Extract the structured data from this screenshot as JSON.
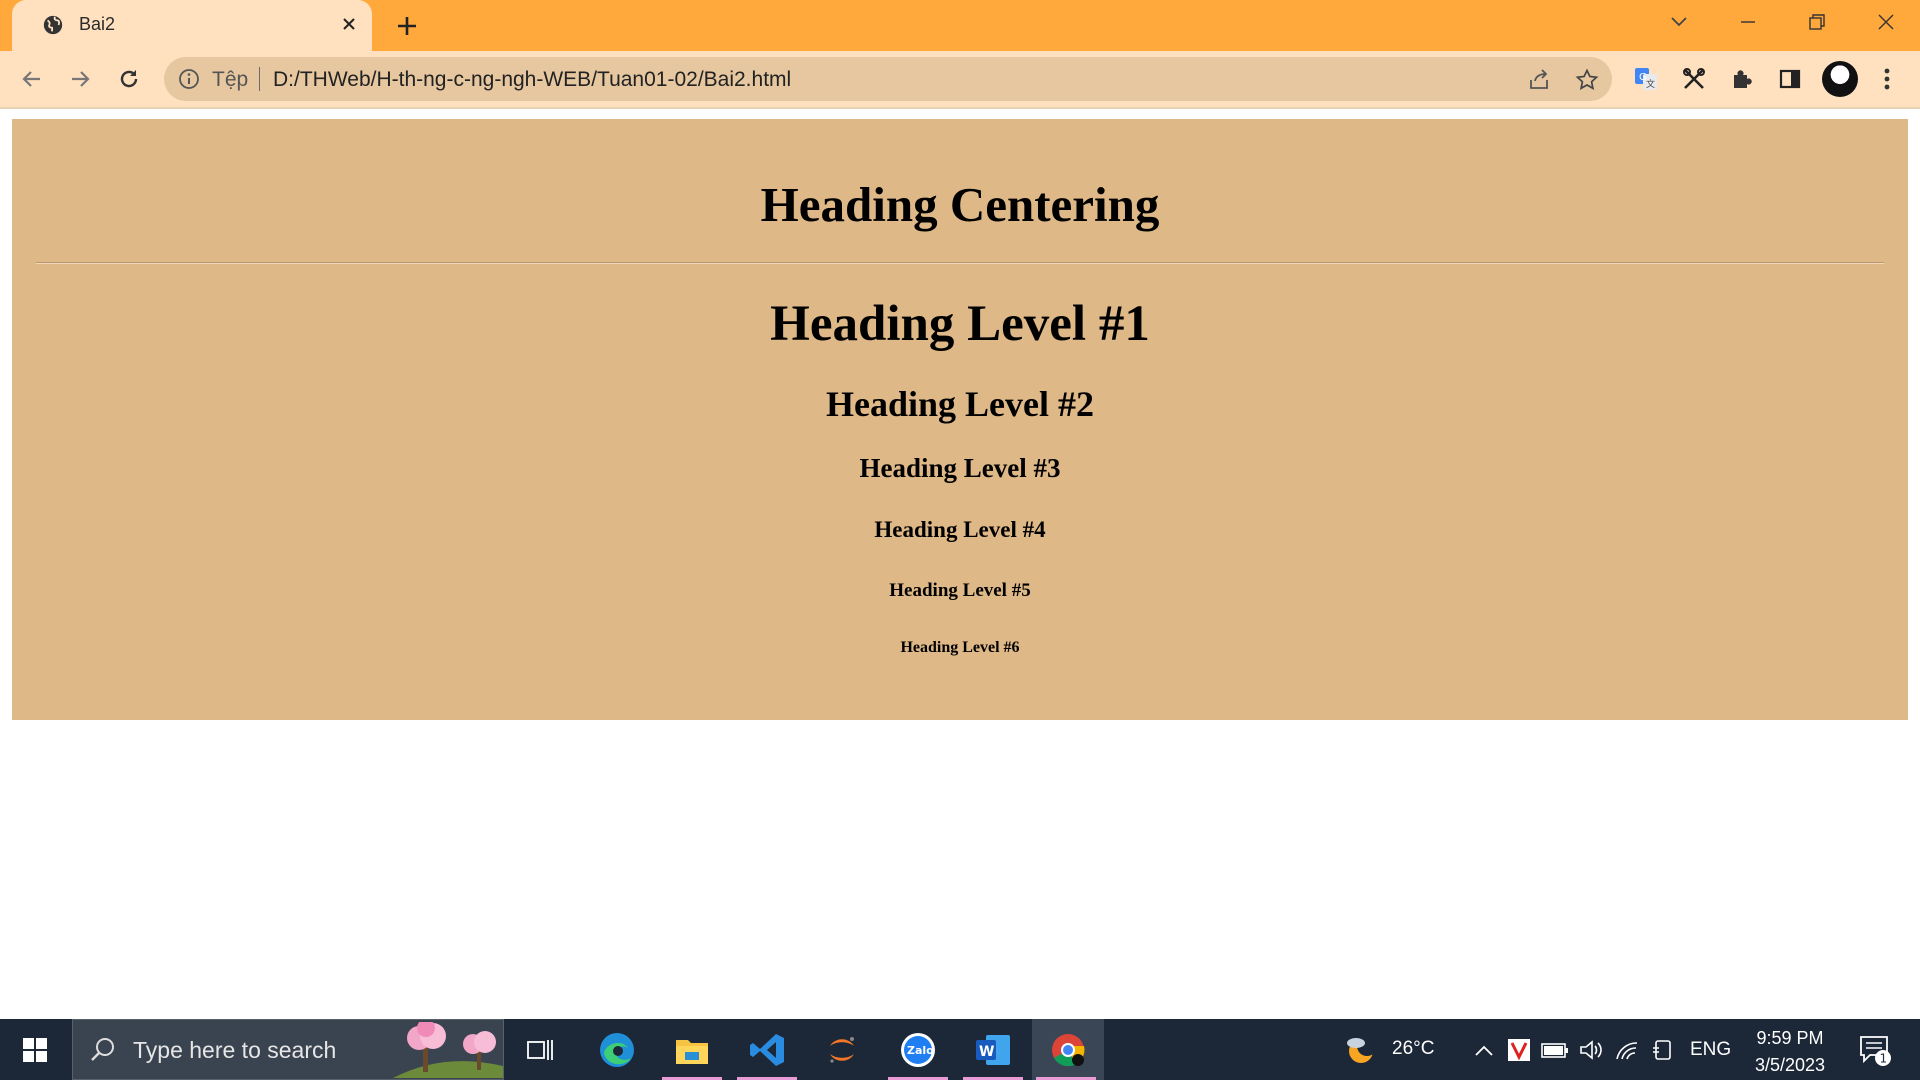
{
  "browser": {
    "tab": {
      "title": "Bai2"
    },
    "address_bar": {
      "scheme_label": "Tệp",
      "url": "D:/THWeb/H-th-ng-c-ng-ngh-WEB/Tuan01-02/Bai2.html"
    }
  },
  "page": {
    "heading_centering": "Heading Centering",
    "headings": [
      "Heading Level #1",
      "Heading Level #2",
      "Heading Level #3",
      "Heading Level #4",
      "Heading Level #5",
      "Heading Level #6"
    ],
    "panel_color": "#dfb887"
  },
  "taskbar": {
    "search_placeholder": "Type here to search",
    "weather": "26°C",
    "language": "ENG",
    "time": "9:59 PM",
    "date": "3/5/2023",
    "notification_count": "1"
  },
  "colors": {
    "tabstrip": "#ffa93d",
    "toolbar": "#ffe0bf",
    "omnibox": "#e6c7a0",
    "taskbar": "#1c2737"
  }
}
